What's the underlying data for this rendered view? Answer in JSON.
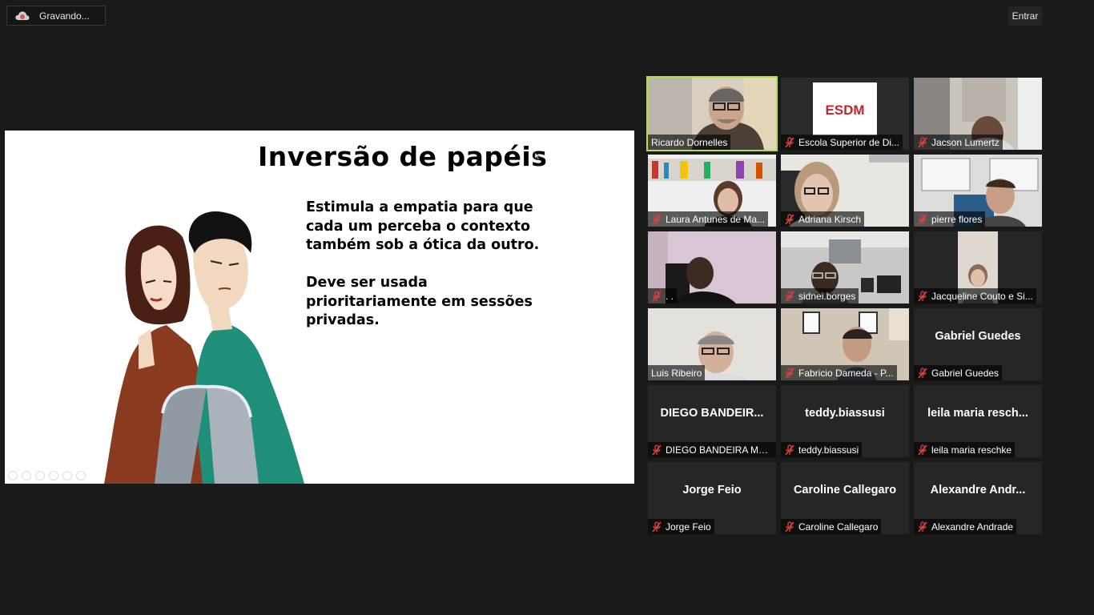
{
  "recording": {
    "label": "Gravando...",
    "icon": "cloud-record-icon",
    "color": "#d9534f"
  },
  "header": {
    "enter_label": "Entrar"
  },
  "slide": {
    "title": "Inversão de papéis",
    "paragraph1": "Estimula a empatia para que cada um perceba o contexto também sob a ótica da outro.",
    "paragraph2": "Deve ser usada prioritariamente em sessões privadas."
  },
  "participants": [
    {
      "name": "Ricardo Dornelles",
      "display": "",
      "muted": false,
      "active": true,
      "video": "man-glasses"
    },
    {
      "name": "Escola Superior de Di...",
      "display": "",
      "muted": true,
      "active": false,
      "video": "esdm-logo",
      "logo_text": "ESDM"
    },
    {
      "name": "Jacson Lumertz",
      "display": "",
      "muted": true,
      "active": false,
      "video": "room"
    },
    {
      "name": "Laura Antunes de Ma...",
      "display": "",
      "muted": true,
      "active": false,
      "video": "bookshelf-woman"
    },
    {
      "name": "Adriana Kirsch",
      "display": "",
      "muted": true,
      "active": false,
      "video": "woman-glasses"
    },
    {
      "name": "pierre flores",
      "display": "",
      "muted": true,
      "active": false,
      "video": "man-window"
    },
    {
      "name": ". .",
      "display": "",
      "muted": true,
      "active": false,
      "video": "man-pink-wall"
    },
    {
      "name": "sidnei.borges",
      "display": "",
      "muted": true,
      "active": false,
      "video": "office-man"
    },
    {
      "name": "Jacqueline Couto e Si...",
      "display": "",
      "muted": true,
      "active": false,
      "video": "woman-small"
    },
    {
      "name": "Luis Ribeiro",
      "display": "",
      "muted": false,
      "active": false,
      "video": "man-gray"
    },
    {
      "name": "Fabricio Dameda - P...",
      "display": "",
      "muted": true,
      "active": false,
      "video": "man-frames"
    },
    {
      "name": "Gabriel Guedes",
      "display": "Gabriel Guedes",
      "muted": true,
      "active": false,
      "video": ""
    },
    {
      "name": "DIEGO BANDEIRA MA...",
      "display": "DIEGO BANDEIR...",
      "muted": true,
      "active": false,
      "video": ""
    },
    {
      "name": "teddy.biassusi",
      "display": "teddy.biassusi",
      "muted": true,
      "active": false,
      "video": ""
    },
    {
      "name": "leila maria reschke",
      "display": "leila maria resch...",
      "muted": true,
      "active": false,
      "video": ""
    },
    {
      "name": "Jorge Feio",
      "display": "Jorge Feio",
      "muted": true,
      "active": false,
      "video": ""
    },
    {
      "name": "Caroline Callegaro",
      "display": "Caroline Callegaro",
      "muted": true,
      "active": false,
      "video": ""
    },
    {
      "name": "Alexandre Andrade",
      "display": "Alexandre  Andr...",
      "muted": true,
      "active": false,
      "video": ""
    }
  ],
  "colors": {
    "active_speaker": "#b3e14b",
    "muted_icon": "#e0403a",
    "background": "#1a1a1a"
  }
}
